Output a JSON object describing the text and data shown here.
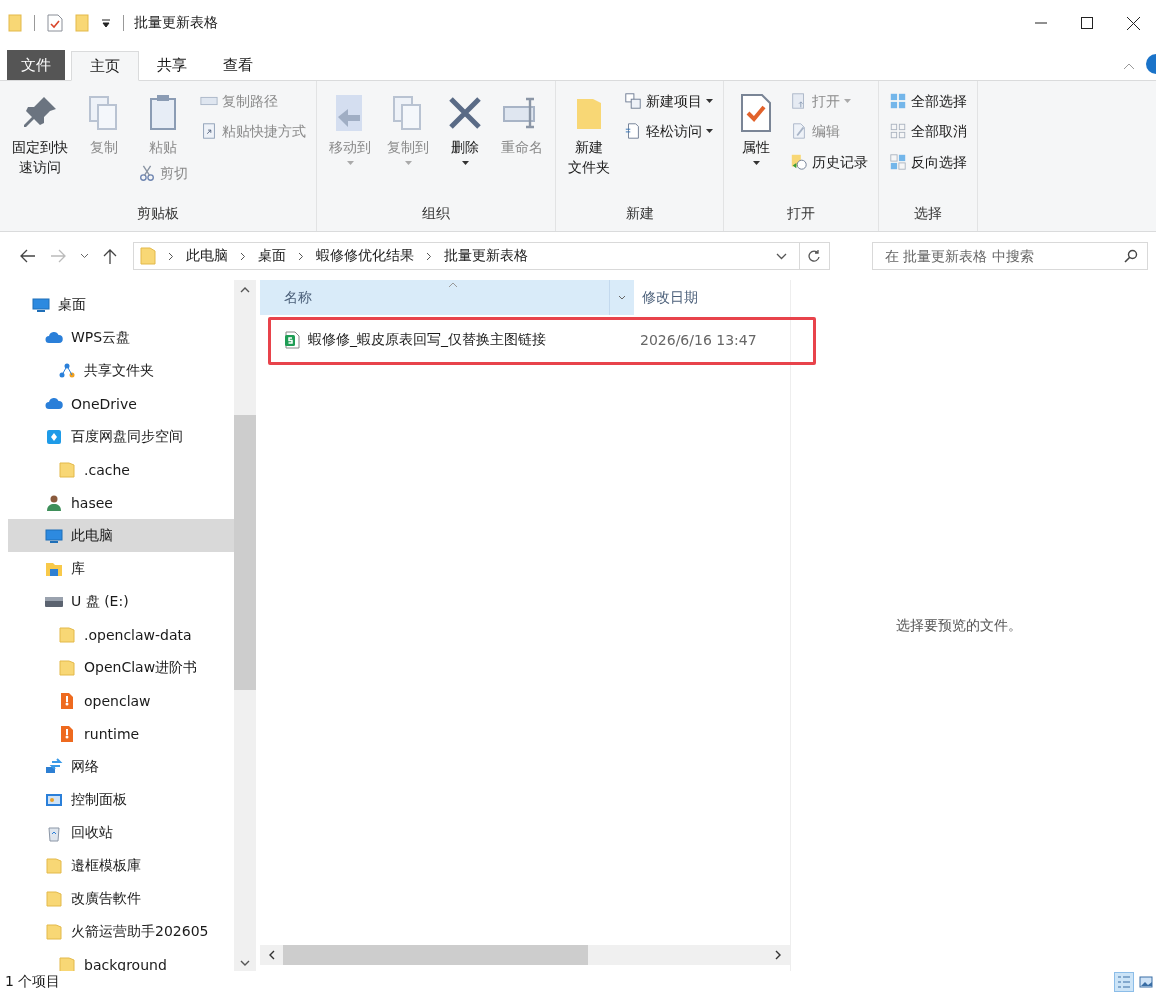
{
  "window": {
    "title": "批量更新表格"
  },
  "ribbon_tabs": [
    {
      "label": "文件",
      "kind": "file",
      "selected": false
    },
    {
      "label": "主页",
      "kind": "tab",
      "selected": true
    },
    {
      "label": "共享",
      "kind": "tab",
      "selected": false
    },
    {
      "label": "查看",
      "kind": "tab",
      "selected": false
    }
  ],
  "ribbon_groups": [
    {
      "label": "剪贴板",
      "columns": [
        [
          {
            "lines": [
              "固定到快",
              "速访问"
            ],
            "kind": "large",
            "disabled": false,
            "dropdown": false
          }
        ],
        [
          {
            "lines": [
              "复制"
            ],
            "kind": "large",
            "disabled": true,
            "dropdown": false
          }
        ],
        [
          {
            "lines": [
              "粘贴"
            ],
            "kind": "large",
            "disabled": true,
            "dropdown": false
          },
          {
            "lines": [
              "剪切"
            ],
            "kind": "small",
            "disabled": true,
            "dropdown": false
          }
        ],
        [
          {
            "lines": [
              "复制路径"
            ],
            "kind": "small",
            "disabled": true,
            "dropdown": false
          },
          {
            "lines": [
              "粘贴快捷方式"
            ],
            "kind": "small",
            "disabled": true,
            "dropdown": false
          }
        ]
      ]
    },
    {
      "label": "组织",
      "columns": [
        [
          {
            "lines": [
              "移动到"
            ],
            "kind": "large",
            "disabled": true,
            "dropdown": true
          }
        ],
        [
          {
            "lines": [
              "复制到"
            ],
            "kind": "large",
            "disabled": true,
            "dropdown": true
          }
        ],
        [
          {
            "lines": [
              "删除"
            ],
            "kind": "large",
            "disabled": false,
            "dropdown": true
          }
        ],
        [
          {
            "lines": [
              "重命名"
            ],
            "kind": "large",
            "disabled": true,
            "dropdown": false
          }
        ]
      ]
    },
    {
      "label": "新建",
      "columns": [
        [
          {
            "lines": [
              "新建",
              "文件夹"
            ],
            "kind": "large",
            "disabled": false,
            "dropdown": false
          }
        ],
        [
          {
            "lines": [
              "新建项目"
            ],
            "kind": "small",
            "disabled": false,
            "dropdown": true
          },
          {
            "lines": [
              "轻松访问"
            ],
            "kind": "small",
            "disabled": false,
            "dropdown": true
          }
        ]
      ]
    },
    {
      "label": "打开",
      "columns": [
        [
          {
            "lines": [
              "属性"
            ],
            "kind": "large",
            "disabled": false,
            "dropdown": true
          }
        ],
        [
          {
            "lines": [
              "打开"
            ],
            "kind": "small",
            "disabled": true,
            "dropdown": true
          },
          {
            "lines": [
              "编辑"
            ],
            "kind": "small",
            "disabled": true,
            "dropdown": false
          },
          {
            "lines": [
              "历史记录"
            ],
            "kind": "small",
            "disabled": false,
            "dropdown": false
          }
        ]
      ]
    },
    {
      "label": "选择",
      "columns": [
        [
          {
            "lines": [
              "全部选择"
            ],
            "kind": "small",
            "disabled": false,
            "dropdown": false
          },
          {
            "lines": [
              "全部取消"
            ],
            "kind": "small",
            "disabled": false,
            "dropdown": false
          },
          {
            "lines": [
              "反向选择"
            ],
            "kind": "small",
            "disabled": false,
            "dropdown": false
          }
        ]
      ]
    }
  ],
  "address_bar": {
    "forward_disabled": true,
    "path": [
      "此电脑",
      "桌面",
      "蝦修修优化结果",
      "批量更新表格"
    ]
  },
  "search": {
    "placeholder": "在 批量更新表格 中搜索"
  },
  "sidebar": {
    "items": [
      {
        "label": "桌面",
        "kind": "desktop",
        "selected": false,
        "children": [
          {
            "label": "WPS云盘",
            "kind": "cloud",
            "selected": false,
            "children": [
              {
                "label": "共享文件夹",
                "kind": "share",
                "selected": false
              }
            ]
          },
          {
            "label": "OneDrive",
            "kind": "cloud",
            "selected": false
          },
          {
            "label": "百度网盘同步空间",
            "kind": "sync",
            "selected": false,
            "children": [
              {
                "label": ".cache",
                "kind": "folder",
                "selected": false
              }
            ]
          },
          {
            "label": "hasee",
            "kind": "user",
            "selected": false
          },
          {
            "label": "此电脑",
            "kind": "pc",
            "selected": true
          },
          {
            "label": "库",
            "kind": "library",
            "selected": false
          },
          {
            "label": "U 盘 (E:)",
            "kind": "drive",
            "selected": false,
            "children": [
              {
                "label": ".openclaw-data",
                "kind": "folder",
                "selected": false
              },
              {
                "label": "OpenClaw进阶书",
                "kind": "folder",
                "selected": false
              },
              {
                "label": "openclaw",
                "kind": "archive",
                "selected": false
              },
              {
                "label": "runtime",
                "kind": "archive",
                "selected": false
              }
            ]
          },
          {
            "label": "网络",
            "kind": "network",
            "selected": false
          },
          {
            "label": "控制面板",
            "kind": "control",
            "selected": false
          },
          {
            "label": "回收站",
            "kind": "bin",
            "selected": false
          },
          {
            "label": "邉框模板庫",
            "kind": "folder",
            "selected": false
          },
          {
            "label": "改廣告軟件",
            "kind": "folder",
            "selected": false
          },
          {
            "label": "火箭运营助手202605",
            "kind": "folder",
            "selected": false,
            "children": [
              {
                "label": "background",
                "kind": "folder",
                "selected": false
              }
            ]
          }
        ]
      }
    ]
  },
  "file_list": {
    "columns": [
      {
        "label": "名称",
        "sorted": true
      },
      {
        "label": "修改日期",
        "sorted": false
      }
    ],
    "rows": [
      {
        "name": "蝦修修_蝦皮原表回写_仅替换主图链接",
        "modified": "2026/6/16 13:47",
        "highlighted": true
      }
    ]
  },
  "preview": {
    "message": "选择要预览的文件。"
  },
  "status_bar": {
    "item_count": "1 个项目",
    "view_buttons": [
      {
        "kind": "details",
        "selected": true
      },
      {
        "kind": "large_icons",
        "selected": false
      }
    ]
  }
}
